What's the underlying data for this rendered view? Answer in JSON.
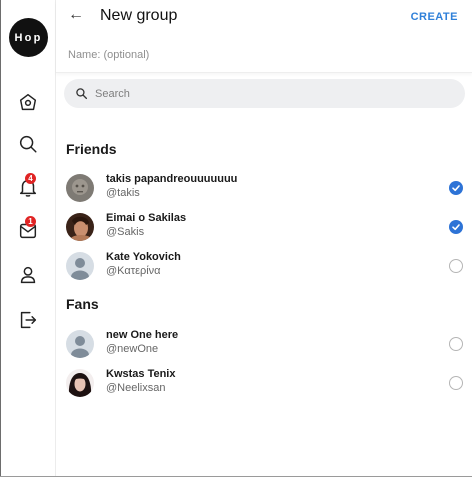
{
  "app": {
    "logo_text": "Hop"
  },
  "sidebar": {
    "items": [
      {
        "icon": "home-icon"
      },
      {
        "icon": "search-icon"
      },
      {
        "icon": "bell-icon",
        "badge": "4"
      },
      {
        "icon": "mail-icon",
        "badge": "1"
      },
      {
        "icon": "user-icon"
      },
      {
        "icon": "logout-icon"
      }
    ]
  },
  "header": {
    "title": "New group",
    "create_label": "CREATE",
    "name_placeholder": "Name: (optional)"
  },
  "search": {
    "placeholder": "Search"
  },
  "sections": {
    "friends_title": "Friends",
    "fans_title": "Fans"
  },
  "friends": [
    {
      "name": "takis papandreouuuuuuu",
      "handle": "@takis",
      "selected": true
    },
    {
      "name": "Eimai o Sakilas",
      "handle": "@Sakis",
      "selected": true
    },
    {
      "name": "Kate Yokovich",
      "handle": "@Κατερίνα",
      "selected": false
    }
  ],
  "fans": [
    {
      "name": "new One here",
      "handle": "@newOne",
      "selected": false
    },
    {
      "name": "Kwstas Tenix",
      "handle": "@Neelixsan",
      "selected": false
    }
  ],
  "colors": {
    "accent": "#2f80d9",
    "checked": "#2d73d6",
    "badge": "#e02424"
  }
}
